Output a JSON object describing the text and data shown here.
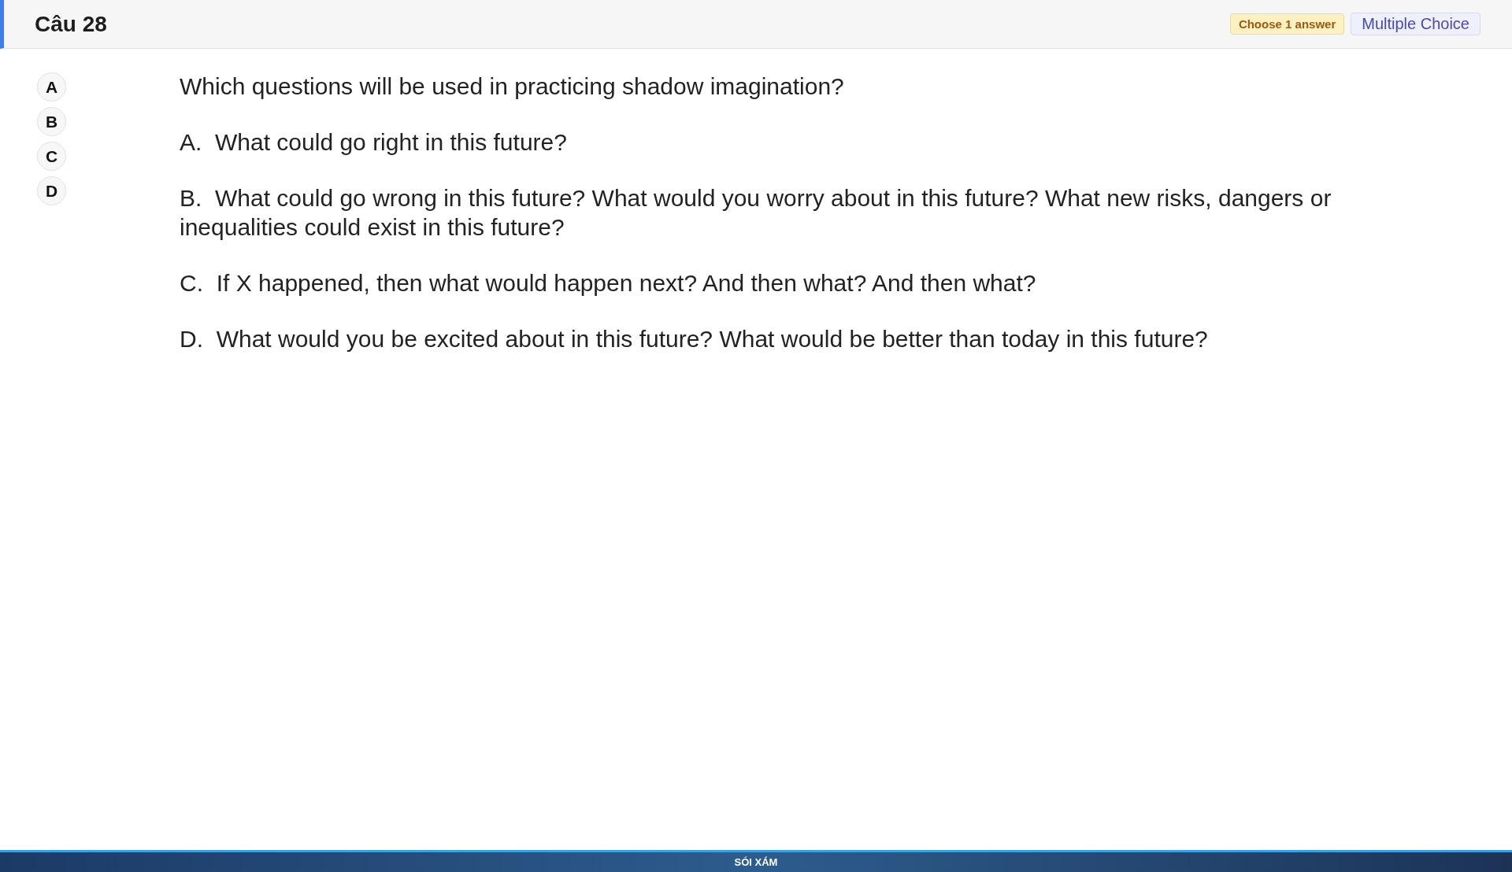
{
  "header": {
    "title": "Câu 28",
    "badges": [
      {
        "kind": "hint",
        "text": "Choose 1 answer"
      },
      {
        "kind": "type",
        "text": "Multiple Choice"
      }
    ]
  },
  "options": [
    "A",
    "B",
    "C",
    "D"
  ],
  "question": {
    "prompt": "Which questions will be used in practicing shadow imagination?",
    "answers": [
      {
        "letter": "A.",
        "text": "What could go right in this future?"
      },
      {
        "letter": "B.",
        "text": "What could go wrong in this future? What would you worry about in this future? What new risks, dangers or inequalities could exist in this future?"
      },
      {
        "letter": "C.",
        "text": "If X happened, then what would happen next? And then what? And then what?"
      },
      {
        "letter": "D.",
        "text": "What would you be excited about in this future? What would be better than today in this future?"
      }
    ]
  },
  "footer": {
    "text": "SÓI XÁM"
  }
}
